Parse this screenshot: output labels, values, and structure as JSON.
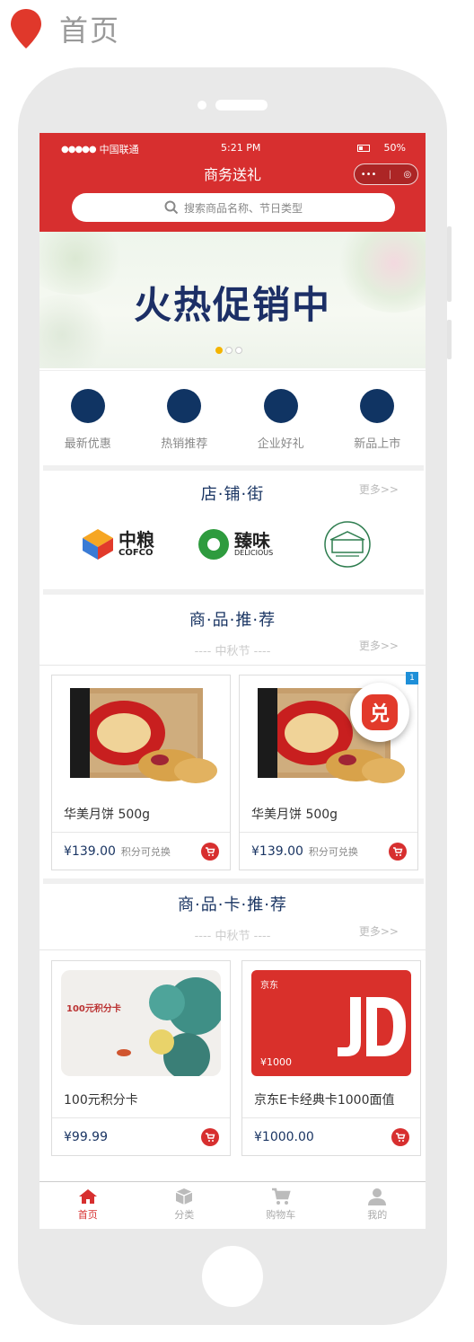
{
  "page": {
    "title": "首页"
  },
  "status_bar": {
    "carrier_dots": "●●●●●",
    "carrier": "中国联通",
    "time": "5:21 PM",
    "battery": "50%"
  },
  "nav": {
    "title": "商务送礼",
    "capsule_more": "•••",
    "capsule_close": "◎"
  },
  "search": {
    "placeholder": "搜索商品名称、节日类型"
  },
  "banner": {
    "text": "火热促销中",
    "dots": 3,
    "active_dot": 0
  },
  "categories": [
    {
      "label": "最新优惠"
    },
    {
      "label": "热销推荐"
    },
    {
      "label": "企业好礼"
    },
    {
      "label": "新品上市"
    }
  ],
  "shops": {
    "title": "店·铺·街",
    "more": "更多>>",
    "items": [
      {
        "name": "中粮",
        "sub": "COFCO"
      },
      {
        "name": "臻味",
        "sub": "DELICIOUS"
      },
      {
        "name": ""
      }
    ]
  },
  "products": {
    "title": "商·品·推·荐",
    "subtitle": "---- 中秋节 ----",
    "more": "更多>>",
    "items": [
      {
        "name": "华美月饼 500g",
        "price": "¥139.00",
        "note": "积分可兑换"
      },
      {
        "name": "华美月饼 500g",
        "price": "¥139.00",
        "note": "积分可兑换"
      }
    ],
    "badge": "1",
    "exchange": "兑"
  },
  "cards": {
    "title": "商·品·卡·推·荐",
    "subtitle": "---- 中秋节 ----",
    "more": "更多>>",
    "items": [
      {
        "name": "100元积分卡",
        "price": "¥99.99",
        "img_text": "100元积分卡"
      },
      {
        "name": "京东E卡经典卡1000面值",
        "price": "¥1000.00",
        "img_text": "¥1000",
        "brand": "京东"
      }
    ]
  },
  "tabbar": [
    {
      "label": "首页",
      "icon": "home-icon",
      "active": true
    },
    {
      "label": "分类",
      "icon": "box-icon",
      "active": false
    },
    {
      "label": "购物车",
      "icon": "cart-icon",
      "active": false
    },
    {
      "label": "我的",
      "icon": "user-icon",
      "active": false
    }
  ],
  "colors": {
    "brand_red": "#d72f2f",
    "navy": "#1a3563",
    "category_circle": "#103463"
  }
}
